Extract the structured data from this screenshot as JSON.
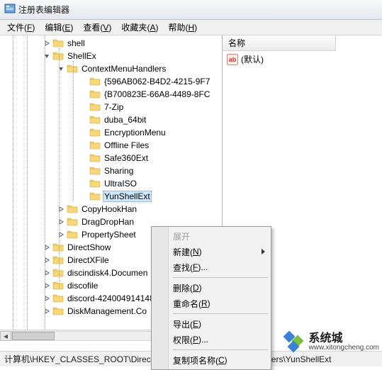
{
  "titlebar": {
    "title": "注册表编辑器"
  },
  "menubar": {
    "items": [
      {
        "label": "文件",
        "mnemonic": "F"
      },
      {
        "label": "编辑",
        "mnemonic": "E"
      },
      {
        "label": "查看",
        "mnemonic": "V"
      },
      {
        "label": "收藏夹",
        "mnemonic": "A"
      },
      {
        "label": "帮助",
        "mnemonic": "H"
      }
    ]
  },
  "right_pane": {
    "column_header": "名称",
    "rows": [
      {
        "icon": "ab",
        "label": "(默认)"
      }
    ]
  },
  "tree": {
    "shell": "shell",
    "shellex": "ShellEx",
    "cmh": "ContextMenuHandlers",
    "cmh_children": [
      "{596AB062-B4D2-4215-9F7",
      "{B700823E-66A8-4489-8FC",
      "7-Zip",
      "duba_64bit",
      "EncryptionMenu",
      "Offline Files",
      "Safe360Ext",
      "Sharing",
      "UltraISO",
      "YunShellExt"
    ],
    "after_cmh": [
      "CopyHookHan",
      "DragDropHan",
      "PropertySheet"
    ],
    "after_shellex": [
      "DirectShow",
      "DirectXFile",
      "discindisk4.Documen",
      "discofile",
      "discord-424004914148",
      "DiskManagement.Co"
    ],
    "selected": "YunShellExt"
  },
  "context_menu": {
    "items": [
      {
        "label": "展开",
        "disabled": true
      },
      {
        "label": "新建",
        "mnemonic": "N",
        "submenu": true
      },
      {
        "label": "查找",
        "mnemonic": "F",
        "ellipsis": true
      },
      {
        "sep": true
      },
      {
        "label": "删除",
        "mnemonic": "D"
      },
      {
        "label": "重命名",
        "mnemonic": "R"
      },
      {
        "sep": true
      },
      {
        "label": "导出",
        "mnemonic": "E"
      },
      {
        "label": "权限",
        "mnemonic": "P",
        "ellipsis": true
      },
      {
        "sep": true
      },
      {
        "label": "复制项名称",
        "mnemonic": "C"
      }
    ]
  },
  "statusbar": {
    "path": "计算机\\HKEY_CLASSES_ROOT\\Directory\\ShellEx\\ContextMenuHandlers\\YunShellExt"
  },
  "watermark": {
    "text": "系统城",
    "url": "www.xitongcheng.com"
  }
}
